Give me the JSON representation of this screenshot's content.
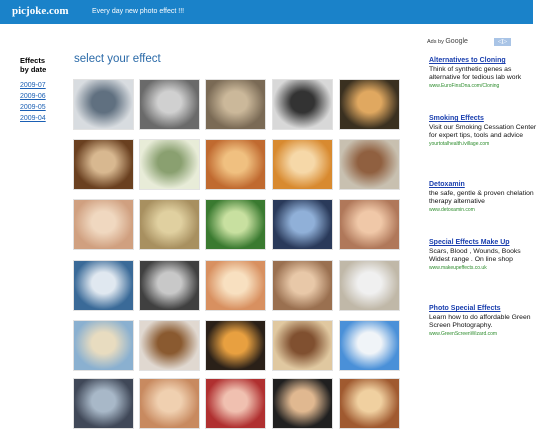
{
  "header": {
    "logo": "picjoke.com",
    "tagline": "Every day new photo effect !!!"
  },
  "sidebar": {
    "title": "Effects by date",
    "links": [
      "2009-07",
      "2009-06",
      "2009-05",
      "2009-04"
    ]
  },
  "main": {
    "heading": "select your effect"
  },
  "ads_header": {
    "ads_by": "Ads by",
    "google": "Google",
    "nav": "◁▷"
  },
  "ads": [
    {
      "title": "Alternatives to Cloning",
      "body": "Think of synthetic genes as alternative for tedious lab work",
      "url": "www.EuroFinsDna.com/Cloning"
    },
    {
      "title": "Smoking Effects",
      "body": "Visit our Smoking Cessation Center for expert tips, tools and advice",
      "url": "yourtotalhealth.ivillage.com"
    },
    {
      "title": "Detoxamin",
      "body": "the safe, gentle & proven chelation therapy alternative",
      "url": "www.detoxamin.com"
    },
    {
      "title": "Special Effects Make Up",
      "body": "Scars, Blood , Wounds, Books Widest range . On line shop",
      "url": "www.makeupeffects.co.uk"
    },
    {
      "title": "Photo Special Effects",
      "body": "Learn how to do affordable Green Screen Photography.",
      "url": "www.GreenScreenWizard.com"
    }
  ],
  "thumbs": [
    {
      "name": "effect-portrait-sepia",
      "bg": "#c98a5a",
      "fg": "#f1d4b0"
    },
    {
      "name": "effect-eye",
      "bg": "#6a6a6a",
      "fg": "#d0d0d0"
    },
    {
      "name": "effect-soldiers",
      "bg": "#7a6a55",
      "fg": "#cbb89a"
    },
    {
      "name": "effect-fashion",
      "bg": "#d8d8d8",
      "fg": "#333333"
    },
    {
      "name": "effect-billboard-night",
      "bg": "#3a3020",
      "fg": "#e0a860"
    },
    {
      "name": "effect-book",
      "bg": "#6a4020",
      "fg": "#d8b890"
    },
    {
      "name": "effect-stamp",
      "bg": "#e8ecd8",
      "fg": "#8aa070"
    },
    {
      "name": "effect-painting",
      "bg": "#c06a30",
      "fg": "#f0c080"
    },
    {
      "name": "effect-frame-gallery",
      "bg": "#d88a30",
      "fg": "#f6d8a8"
    },
    {
      "name": "effect-tv",
      "bg": "#c8c0b0",
      "fg": "#906040"
    },
    {
      "name": "effect-collage",
      "bg": "#d0a080",
      "fg": "#f0d8c0"
    },
    {
      "name": "effect-wall-frame",
      "bg": "#a89060",
      "fg": "#e0d0a0"
    },
    {
      "name": "effect-leaves",
      "bg": "#3a7a30",
      "fg": "#c8e0a0"
    },
    {
      "name": "effect-bus-stop",
      "bg": "#2a3a5a",
      "fg": "#90b0d8"
    },
    {
      "name": "effect-flowers",
      "bg": "#b0785a",
      "fg": "#f0c8a8"
    },
    {
      "name": "effect-stadium",
      "bg": "#3a6a98",
      "fg": "#e0e8f0"
    },
    {
      "name": "effect-bw-laptop",
      "bg": "#404040",
      "fg": "#c8c8c8"
    },
    {
      "name": "effect-puzzle",
      "bg": "#d89060",
      "fg": "#f8e0c0"
    },
    {
      "name": "effect-phone-girl",
      "bg": "#9a7050",
      "fg": "#e8c8a8"
    },
    {
      "name": "effect-canvas",
      "bg": "#c0b8a8",
      "fg": "#f0f0f0"
    },
    {
      "name": "effect-beach-polaroid",
      "bg": "#8ab0d0",
      "fg": "#e8dcc0"
    },
    {
      "name": "effect-coffee",
      "bg": "#e0d8d0",
      "fg": "#8a5a30"
    },
    {
      "name": "effect-silhouette",
      "bg": "#2a2018",
      "fg": "#e8a040"
    },
    {
      "name": "effect-vintage-phone",
      "bg": "#e0c8a0",
      "fg": "#805030"
    },
    {
      "name": "effect-sky",
      "bg": "#4a90d8",
      "fg": "#f0f4f8"
    },
    {
      "name": "effect-tablet",
      "bg": "#404858",
      "fg": "#a8b8c8"
    },
    {
      "name": "effect-face-split",
      "bg": "#c88a60",
      "fg": "#f0d0b0"
    },
    {
      "name": "effect-red-dress",
      "bg": "#b03030",
      "fg": "#f0c0b0"
    },
    {
      "name": "effect-filmstrip",
      "bg": "#202020",
      "fg": "#e0b890"
    },
    {
      "name": "effect-blonde-film",
      "bg": "#a05a30",
      "fg": "#f0d0a0"
    },
    {
      "name": "effect-shattered",
      "bg": "#d8dce0",
      "fg": "#607080"
    }
  ]
}
